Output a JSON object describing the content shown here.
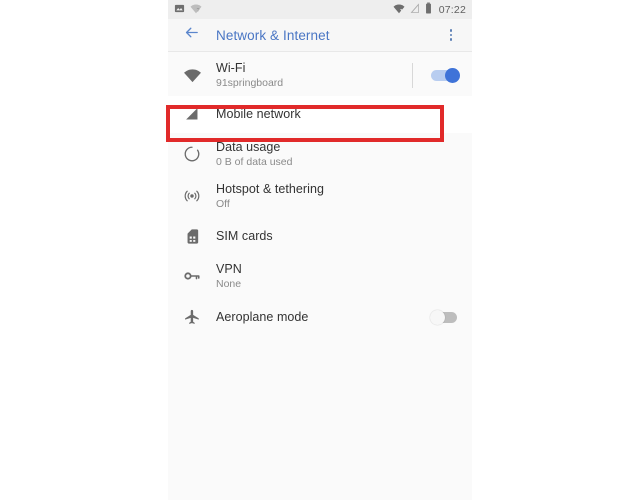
{
  "status_bar": {
    "left_icons": [
      "screenshot-icon",
      "wifi-question-icon"
    ],
    "right_icons": [
      "wifi-off-icon",
      "signal-off-icon",
      "battery-icon"
    ],
    "time": "07:22"
  },
  "toolbar": {
    "back_icon": "back-arrow-icon",
    "title": "Network & Internet",
    "overflow_icon": "more-vert-icon",
    "title_color": "#4a76c4"
  },
  "settings": {
    "rows": [
      {
        "key": "wifi",
        "icon": "wifi-icon",
        "title": "Wi-Fi",
        "subtitle": "91springboard",
        "toggle": "on",
        "divider": true
      },
      {
        "key": "mobile-network",
        "icon": "signal-cellular-icon",
        "title": "Mobile network",
        "subtitle": "",
        "toggle": "none",
        "highlighted": true
      },
      {
        "key": "data-usage",
        "icon": "data-usage-icon",
        "title": "Data usage",
        "subtitle": "0 B of data used",
        "toggle": "none"
      },
      {
        "key": "hotspot-tethering",
        "icon": "hotspot-icon",
        "title": "Hotspot & tethering",
        "subtitle": "Off",
        "toggle": "none"
      },
      {
        "key": "sim-cards",
        "icon": "sim-card-icon",
        "title": "SIM cards",
        "subtitle": "",
        "toggle": "none"
      },
      {
        "key": "vpn",
        "icon": "vpn-key-icon",
        "title": "VPN",
        "subtitle": "None",
        "toggle": "none"
      },
      {
        "key": "aeroplane-mode",
        "icon": "airplane-icon",
        "title": "Aeroplane mode",
        "subtitle": "",
        "toggle": "off"
      }
    ]
  },
  "annotation": {
    "highlight_target": "Mobile network",
    "highlight_color": "#e12a2a"
  }
}
